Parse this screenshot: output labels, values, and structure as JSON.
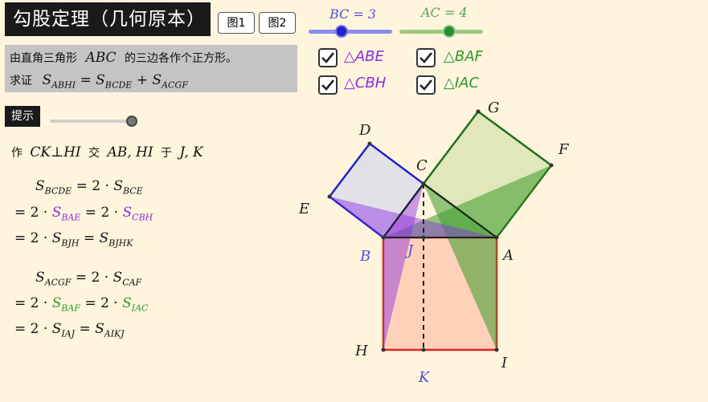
{
  "title": "勾股定理（几何原本）",
  "buttons": {
    "fig1": "图1",
    "fig2": "图2"
  },
  "sliders": {
    "bc": {
      "label": "BC = 3",
      "value": 3,
      "color": "#5050e0",
      "track_color": "#8c8cf0"
    },
    "ac": {
      "label": "AC = 4",
      "value": 4,
      "color": "#2a8a2a",
      "track_color": "#9ccc7c"
    },
    "hint": {
      "value": 1
    }
  },
  "description": {
    "line1_prefix": "由直角三角形",
    "line1_math": "ABC",
    "line1_suffix": "的三边各作个正方形。",
    "line2_prefix": "求证"
  },
  "checkboxes": [
    {
      "label": "△ABE",
      "checked": true,
      "color": "#8a2be2"
    },
    {
      "label": "△BAF",
      "checked": true,
      "color": "#2a9a2a"
    },
    {
      "label": "△CBH",
      "checked": true,
      "color": "#8a2be2"
    },
    {
      "label": "△IAC",
      "checked": true,
      "color": "#2a9a2a"
    }
  ],
  "hint_label": "提示",
  "construction": {
    "zuo": "作",
    "ck_hi": "CK⊥HI",
    "jiao": "交",
    "ab_hi": "AB, HI",
    "yu": "于",
    "jk": "J, K"
  },
  "points": {
    "A": "A",
    "B": "B",
    "C": "C",
    "D": "D",
    "E": "E",
    "F": "F",
    "G": "G",
    "H": "H",
    "I": "I",
    "J": "J",
    "K": "K"
  },
  "colors": {
    "purple_text": "#8a2be2",
    "green_text": "#2a9a2a",
    "blue_label": "#5050e0"
  }
}
